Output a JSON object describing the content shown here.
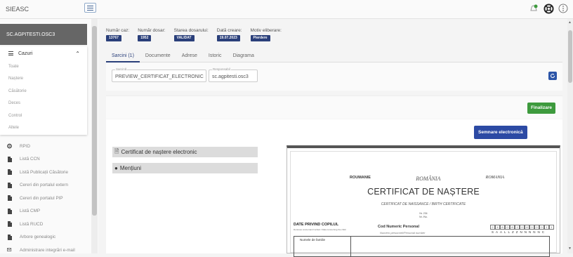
{
  "app": {
    "title": "SIEASC"
  },
  "user": {
    "name": "SC.AGPITESTI.OSC3"
  },
  "sidebar": {
    "section_title": "Cazuri",
    "sub_items": [
      "Toate",
      "Naștere",
      "Căsătorie",
      "Deces",
      "Control",
      "Altele"
    ],
    "nav_items": [
      {
        "label": "RPID",
        "icon": "gear-icon"
      },
      {
        "label": "Listă CCN",
        "icon": "document-icon"
      },
      {
        "label": "Listă Publicații Căsătorie",
        "icon": "document-icon"
      },
      {
        "label": "Cereri din portalul extern",
        "icon": "document-icon"
      },
      {
        "label": "Cereri din portalul PIP",
        "icon": "document-icon"
      },
      {
        "label": "Listă CMP",
        "icon": "document-icon"
      },
      {
        "label": "Listă RUCD",
        "icon": "document-icon"
      },
      {
        "label": "Arbore genealogic",
        "icon": "document-icon"
      },
      {
        "label": "Administrare integrări e-mail",
        "icon": "email-settings-icon"
      }
    ]
  },
  "case_header": [
    {
      "label": "Număr caz:",
      "value": "13767",
      "color": "#2a3f7a"
    },
    {
      "label": "Număr dosar:",
      "value": "1952",
      "color": "#2a3f7a"
    },
    {
      "label": "Starea dosarului:",
      "value": "VALIDAT",
      "color": "#2a3f7a"
    },
    {
      "label": "Dată creare:",
      "value": "19.07.2023",
      "color": "#2a3f7a"
    },
    {
      "label": "Motiv eliberare:",
      "value": "Pierdere",
      "color": "#2a3f7a"
    }
  ],
  "tabs": [
    "Sarcini (1)",
    "Documente",
    "Adrese",
    "Istoric",
    "Diagrama"
  ],
  "fields": {
    "task_label": "Sarcină",
    "task_value": "PREVIEW_CERTIFICAT_ELECTRONIC",
    "owner_label": "Responsabil",
    "owner_value": "sc.agpitesti.osc3"
  },
  "buttons": {
    "finalize": "Finalizare",
    "sign": "Semnare electronică"
  },
  "sections": {
    "certificate": "Certificat de naștere electronic",
    "mentions": "Mențiuni"
  },
  "certificate": {
    "country_left": "ROUMANIE",
    "country_mid": "ROMÂNIA",
    "country_right": "ROMANIA",
    "title": "CERTIFICAT DE NAȘTERE",
    "subtitle": "CERTIFICAT DE NAISSANCE / BIRTH CERTIFICATE",
    "series_line1": "Nr. 234",
    "series_line2": "Nr. /No.",
    "child_data": "DATE PRIVIND COPILUL",
    "child_data_sub": "Données concernant l'enfant / Data concerning the child",
    "cnp_label": "Cod Numeric Personal",
    "cnp_sub": "Numéro personnel/Personal number",
    "cnp_digits": [
      "2",
      "4",
      "8",
      "0",
      "8",
      "1",
      "0",
      "8",
      "0",
      "0",
      "0",
      "1",
      "1"
    ],
    "cnp_letters": "SAALLZZNNNNNC",
    "surname_label": "Numele de familie"
  }
}
